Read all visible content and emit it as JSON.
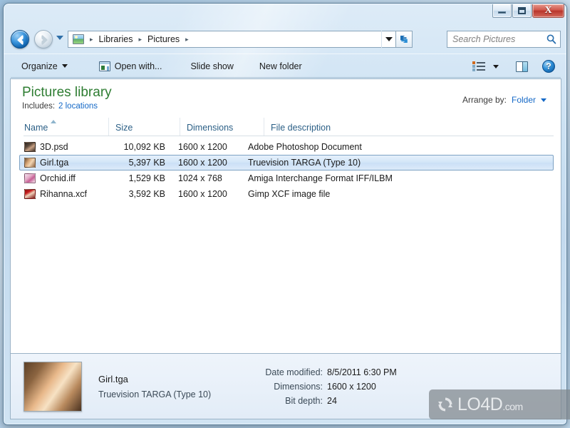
{
  "window": {
    "minimize_label": "Minimize",
    "maximize_label": "Maximize",
    "close_label": "X"
  },
  "nav": {
    "back_label": "Back",
    "forward_label": "Forward",
    "recent_pages_label": "Recent pages",
    "breadcrumbs": [
      "Libraries",
      "Pictures"
    ],
    "separator": "▸",
    "address_dropdown_label": "Previous locations",
    "refresh_label": "Refresh"
  },
  "search": {
    "placeholder": "Search Pictures",
    "value": "Search Pictures",
    "icon": "search-icon"
  },
  "toolbar": {
    "organize_label": "Organize",
    "open_with_label": "Open with...",
    "slide_show_label": "Slide show",
    "new_folder_label": "New folder",
    "view_mode_label": "Change your view",
    "preview_pane_label": "Show the preview pane",
    "help_label": "?"
  },
  "library": {
    "title": "Pictures library",
    "includes_label": "Includes:",
    "locations_link": "2 locations",
    "arrange_by_label": "Arrange by:",
    "arrange_by_value": "Folder"
  },
  "columns": [
    {
      "label": "Name",
      "sort": "ascending"
    },
    {
      "label": "Size",
      "sort": "none"
    },
    {
      "label": "Dimensions",
      "sort": "none"
    },
    {
      "label": "File description",
      "sort": "none"
    }
  ],
  "files": [
    {
      "name": "3D.psd",
      "size": "10,092 KB",
      "dimensions": "1600 x 1200",
      "description": "Adobe Photoshop Document",
      "selected": false
    },
    {
      "name": "Girl.tga",
      "size": "5,397 KB",
      "dimensions": "1600 x 1200",
      "description": "Truevision TARGA (Type 10)",
      "selected": true
    },
    {
      "name": "Orchid.iff",
      "size": "1,529 KB",
      "dimensions": "1024 x 768",
      "description": "Amiga Interchange Format IFF/ILBM",
      "selected": false
    },
    {
      "name": "Rihanna.xcf",
      "size": "3,592 KB",
      "dimensions": "1600 x 1200",
      "description": "Gimp XCF image file",
      "selected": false
    }
  ],
  "details": {
    "filename": "Girl.tga",
    "filetype": "Truevision TARGA (Type 10)",
    "date_modified_label": "Date modified:",
    "date_modified_value": "8/5/2011 6:30 PM",
    "dimensions_label": "Dimensions:",
    "dimensions_value": "1600 x 1200",
    "bit_depth_label": "Bit depth:",
    "bit_depth_value": "24"
  },
  "watermark": {
    "text": "LO4D",
    "suffix": ".com"
  },
  "colors": {
    "library_title": "#2e7d32",
    "link": "#1569c7",
    "column_header": "#2b5f86",
    "selection_border": "#7da2c4",
    "close_button": "#b8362c"
  }
}
